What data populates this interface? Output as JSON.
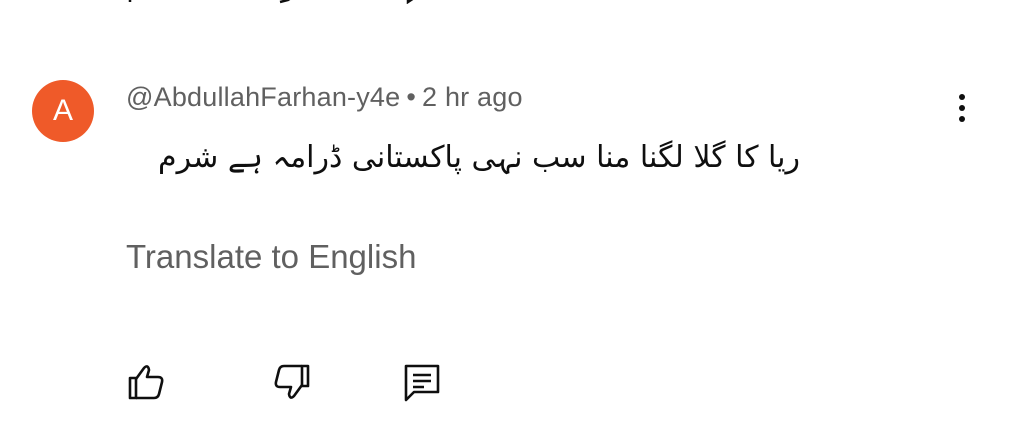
{
  "comment": {
    "avatar_letter": "A",
    "avatar_color": "#ef5a29",
    "author": "@AbdullahFarhan-y4e",
    "separator": "•",
    "timestamp": "2 hr ago",
    "text": "ریا کا گلا لگنا منا سب نہی پاکستانی ڈرامہ ہے شرم",
    "translate_label": "Translate to English"
  },
  "actions": {
    "like_icon": "thumbs-up-icon",
    "dislike_icon": "thumbs-down-icon",
    "reply_icon": "comment-reply-icon",
    "more_icon": "more-vertical-icon"
  },
  "colors": {
    "text_primary": "#0f0f0f",
    "text_secondary": "#606060"
  }
}
